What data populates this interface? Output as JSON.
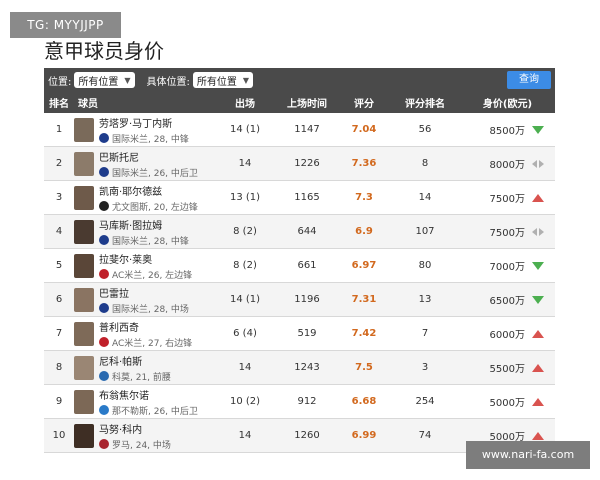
{
  "watermark": "TG: MYYJJPP",
  "page_title": "意甲球员身价",
  "filters": {
    "position_label": "位置:",
    "position_value": "所有位置",
    "specific_label": "具体位置:",
    "specific_value": "所有位置",
    "query_label": "查询"
  },
  "columns": [
    "排名",
    "球员",
    "出场",
    "上场时间",
    "评分",
    "评分排名",
    "身价(欧元)"
  ],
  "players": [
    {
      "rank": "1",
      "name": "劳塔罗·马丁内斯",
      "info": "国际米兰, 28, 中锋",
      "apps": "14 (1)",
      "minutes": "1147",
      "rating": "7.04",
      "rating_rank": "56",
      "value": "8500万",
      "trend": "down",
      "club_color": "#1e3c8c",
      "photo_color": "#7a6a5a"
    },
    {
      "rank": "2",
      "name": "巴斯托尼",
      "info": "国际米兰, 26, 中后卫",
      "apps": "14",
      "minutes": "1226",
      "rating": "7.36",
      "rating_rank": "8",
      "value": "8000万",
      "trend": "flat",
      "club_color": "#1e3c8c",
      "photo_color": "#8c7b6a"
    },
    {
      "rank": "3",
      "name": "凯南·耶尔德兹",
      "info": "尤文图斯, 20, 左边锋",
      "apps": "13 (1)",
      "minutes": "1165",
      "rating": "7.3",
      "rating_rank": "14",
      "value": "7500万",
      "trend": "up",
      "club_color": "#222222",
      "photo_color": "#6e5a4a"
    },
    {
      "rank": "4",
      "name": "马库斯·图拉姆",
      "info": "国际米兰, 28, 中锋",
      "apps": "8 (2)",
      "minutes": "644",
      "rating": "6.9",
      "rating_rank": "107",
      "value": "7500万",
      "trend": "flat",
      "club_color": "#1e3c8c",
      "photo_color": "#4a3a30"
    },
    {
      "rank": "5",
      "name": "拉斐尔·莱奥",
      "info": "AC米兰, 26, 左边锋",
      "apps": "8 (2)",
      "minutes": "661",
      "rating": "6.97",
      "rating_rank": "80",
      "value": "7000万",
      "trend": "down",
      "club_color": "#c0202a",
      "photo_color": "#5a4638"
    },
    {
      "rank": "6",
      "name": "巴雷拉",
      "info": "国际米兰, 28, 中场",
      "apps": "14 (1)",
      "minutes": "1196",
      "rating": "7.31",
      "rating_rank": "13",
      "value": "6500万",
      "trend": "down",
      "club_color": "#1e3c8c",
      "photo_color": "#8a7462"
    },
    {
      "rank": "7",
      "name": "普利西奇",
      "info": "AC米兰, 27, 右边锋",
      "apps": "6 (4)",
      "minutes": "519",
      "rating": "7.42",
      "rating_rank": "7",
      "value": "6000万",
      "trend": "up",
      "club_color": "#c0202a",
      "photo_color": "#7e6a58"
    },
    {
      "rank": "8",
      "name": "尼科·帕斯",
      "info": "科莫, 21, 前腰",
      "apps": "14",
      "minutes": "1243",
      "rating": "7.5",
      "rating_rank": "3",
      "value": "5500万",
      "trend": "up",
      "club_color": "#2a6ab0",
      "photo_color": "#9a8674"
    },
    {
      "rank": "9",
      "name": "布翁焦尔诺",
      "info": "那不勒斯, 26, 中后卫",
      "apps": "10 (2)",
      "minutes": "912",
      "rating": "6.68",
      "rating_rank": "254",
      "value": "5000万",
      "trend": "up",
      "club_color": "#2a7ac8",
      "photo_color": "#7c6856"
    },
    {
      "rank": "10",
      "name": "马努·科内",
      "info": "罗马, 24, 中场",
      "apps": "14",
      "minutes": "1260",
      "rating": "6.99",
      "rating_rank": "74",
      "value": "5000万",
      "trend": "up",
      "club_color": "#a8242e",
      "photo_color": "#3e2e24"
    }
  ],
  "colors": {
    "up": "#d9534f",
    "down": "#4caf50",
    "flat": "#b0b0b0",
    "rating": "#d2691e"
  },
  "site_watermark": "www.nari-fa.com"
}
